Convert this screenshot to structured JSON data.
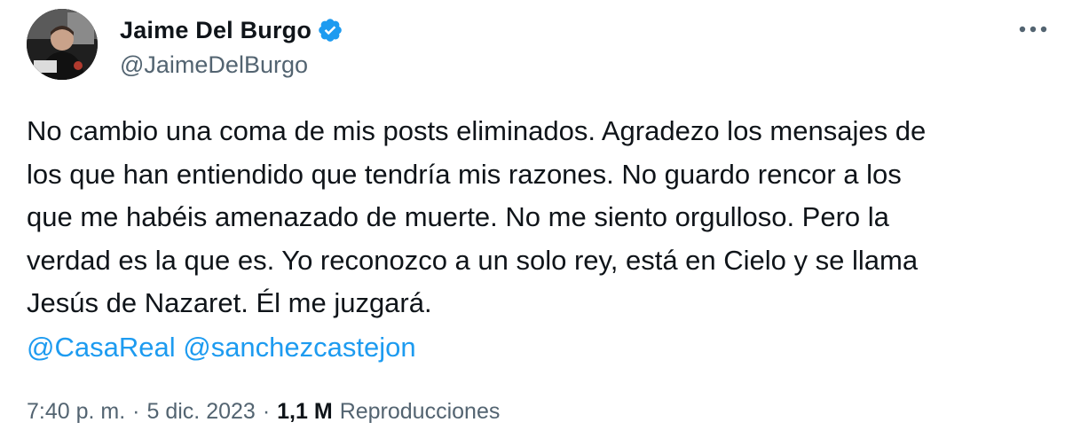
{
  "author": {
    "name": "Jaime Del Burgo",
    "handle": "@JaimeDelBurgo",
    "verified": true,
    "avatar_icon": "profile-photo"
  },
  "tweet": {
    "text": "No cambio una coma de mis posts eliminados. Agradezo los mensajes de\nlos que han entiendido que tendría mis razones. No guardo rencor a los\nque me habéis amenazado de muerte. No me siento orgulloso. Pero la\nverdad es la que es. Yo reconozco a un solo rey, está en Cielo y se llama\nJesús de Nazaret. Él me juzgará.",
    "mentions": [
      "@CasaReal",
      "@sanchezcastejon"
    ]
  },
  "meta": {
    "time": "7:40 p. m.",
    "separator": "·",
    "date": "5 dic. 2023",
    "views_count": "1,1 M",
    "views_label": "Reproducciones"
  },
  "colors": {
    "text": "#0f1419",
    "secondary": "#536471",
    "link": "#1d9bf0",
    "verified": "#1d9bf0"
  }
}
